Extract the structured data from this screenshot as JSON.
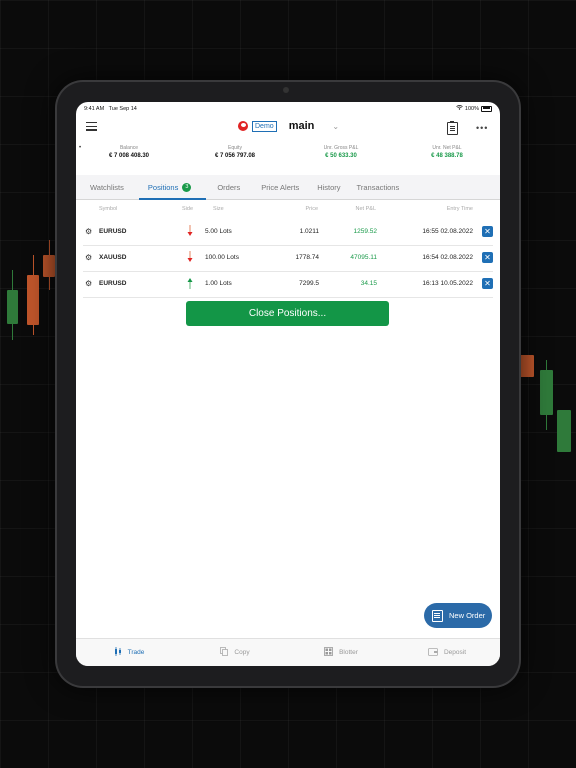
{
  "status": {
    "time": "9:41 AM",
    "date": "Tue Sep 14",
    "battery": "100%"
  },
  "header": {
    "demo_label": "Demo",
    "account": "main",
    "chevron": "⌄",
    "more": "•••"
  },
  "summary": {
    "dot": "•",
    "items": [
      {
        "label": "Balance",
        "value": "€ 7 008 408.30",
        "color": "dark"
      },
      {
        "label": "Equity",
        "value": "€ 7 056 797.08",
        "color": "dark"
      },
      {
        "label": "Unr. Gross P&L",
        "value": "€ 50 633.30",
        "color": "green"
      },
      {
        "label": "Unr. Net P&L",
        "value": "€ 48 388.78",
        "color": "green"
      }
    ]
  },
  "tabs": [
    {
      "label": "Watchlists"
    },
    {
      "label": "Positions",
      "badge": "3"
    },
    {
      "label": "Orders"
    },
    {
      "label": "Price Alerts"
    },
    {
      "label": "History"
    },
    {
      "label": "Transactions"
    }
  ],
  "columns": {
    "symbol": "Symbol",
    "side": "Side",
    "size": "Size",
    "price": "Price",
    "pnl": "Net P&L",
    "time": "Entry Time"
  },
  "rows": [
    {
      "symbol": "EURUSD",
      "side": "sell",
      "size": "5.00 Lots",
      "price": "1.0211",
      "pnl": "1259.52",
      "time": "16:55 02.08.2022"
    },
    {
      "symbol": "XAUUSD",
      "side": "sell",
      "size": "100.00 Lots",
      "price": "1778.74",
      "pnl": "47095.11",
      "time": "16:54 02.08.2022"
    },
    {
      "symbol": "EURUSD",
      "side": "buy",
      "size": "1.00 Lots",
      "price": "7299.5",
      "pnl": "34.15",
      "time": "16:13 10.05.2022"
    }
  ],
  "close_positions_label": "Close Positions...",
  "new_order_label": "New Order",
  "bottom_nav": [
    {
      "label": "Trade",
      "icon": "candles-icon"
    },
    {
      "label": "Copy",
      "icon": "copy-icon"
    },
    {
      "label": "Blotter",
      "icon": "grid-icon"
    },
    {
      "label": "Deposit",
      "icon": "wallet-icon"
    }
  ],
  "colors": {
    "accent": "#1f6fb5",
    "green": "#139647",
    "red": "#e02424"
  }
}
